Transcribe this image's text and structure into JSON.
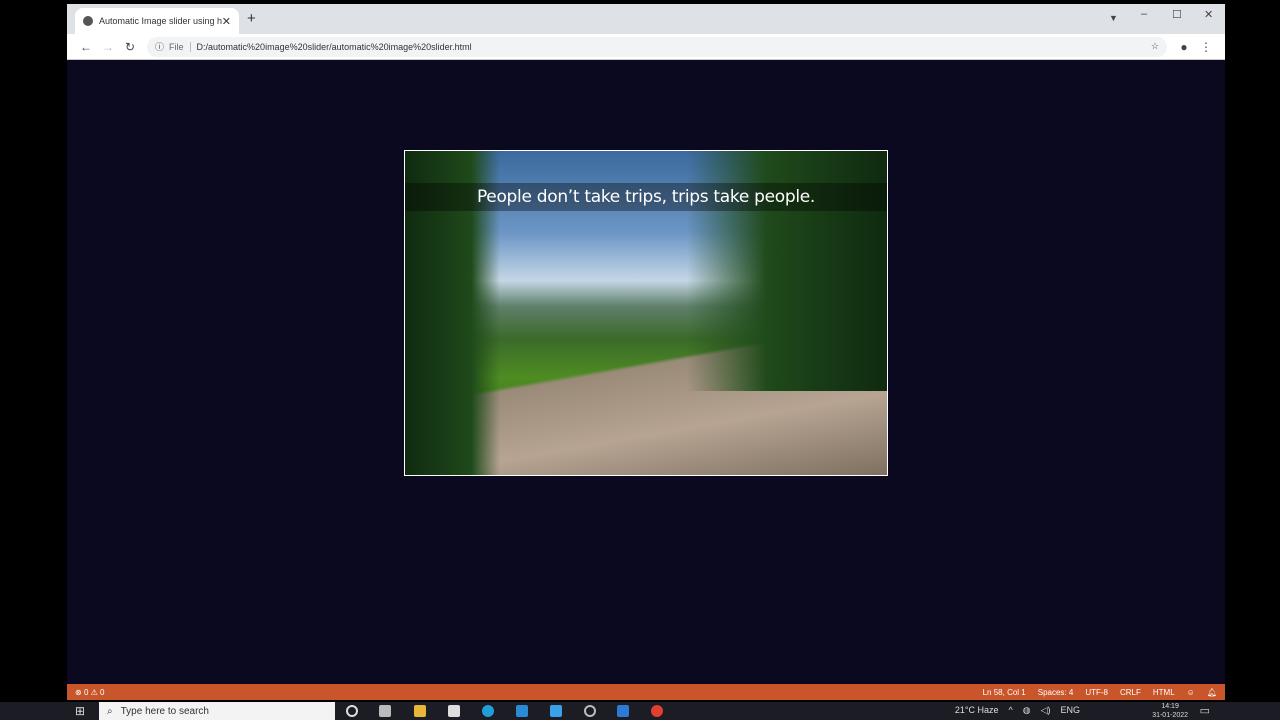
{
  "browser": {
    "tab_title": "Automatic Image slider using ht",
    "url_scheme_label": "File",
    "url": "D:/automatic%20image%20slider/automatic%20image%20slider.html"
  },
  "slider": {
    "caption": "People don’t take trips, trips take people."
  },
  "statusbar": {
    "errors": "0",
    "warnings": "0",
    "position": "Ln 58, Col 1",
    "spaces": "Spaces: 4",
    "encoding": "UTF-8",
    "eol": "CRLF",
    "language": "HTML"
  },
  "taskbar": {
    "search_placeholder": "Type here to search",
    "weather": "21°C  Haze",
    "lang": "ENG",
    "time": "14:19",
    "date": "31-01-2022"
  }
}
